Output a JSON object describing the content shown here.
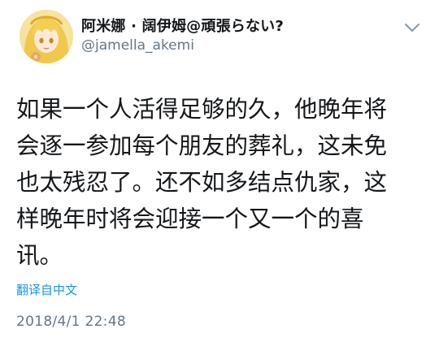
{
  "tweet": {
    "display_name": "阿米娜 · 阔伊姆@頑張らない?",
    "handle": "@jamella_akemi",
    "avatar_icon": "avatar-anime-character",
    "menu_icon": "chevron-down-icon",
    "text_lines": [
      "如果一个人活得足够的久，他晚年将",
      "会逐一参加每个朋友的葬礼，这未免",
      "也太残忍了。还不如多结点仇家，这",
      "样晚年时将会迎接一个又一个的喜",
      "讯。"
    ],
    "translate_label": "翻译自中文",
    "timestamp": "2018/4/1 22:48"
  },
  "colors": {
    "text": "#14171a",
    "secondary": "#657786",
    "link": "#1b95e0",
    "background": "#ffffff"
  }
}
